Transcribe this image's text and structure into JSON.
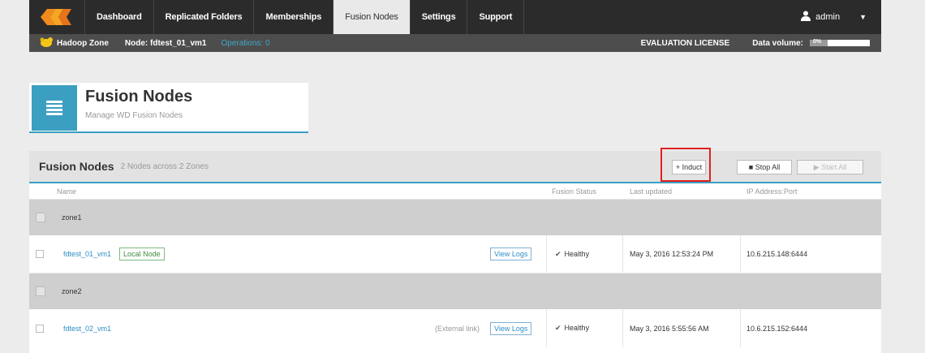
{
  "nav": {
    "tabs": [
      {
        "label": "Dashboard"
      },
      {
        "label": "Replicated Folders"
      },
      {
        "label": "Memberships"
      },
      {
        "label": "Fusion Nodes",
        "active": true
      },
      {
        "label": "Settings"
      },
      {
        "label": "Support"
      }
    ],
    "user": "admin",
    "logo_icon": "wandisco-logo-icon"
  },
  "subbar": {
    "zone": "Hadoop Zone",
    "node": "Node: fdtest_01_vm1",
    "operations": "Operations: 0",
    "license": "EVALUATION LICENSE",
    "data_volume_label": "Data volume:",
    "data_volume_text": "0%",
    "data_volume_fraction": 0.3
  },
  "title": {
    "heading": "Fusion Nodes",
    "subtitle": "Manage WD Fusion Nodes"
  },
  "panel": {
    "heading": "Fusion Nodes",
    "summary": "2 Nodes across 2 Zones",
    "buttons": {
      "induct": "+ Induct",
      "stop_all": "■ Stop All",
      "start_all": "▶ Start All"
    },
    "columns": {
      "name": "Name",
      "status": "Fusion Status",
      "updated": "Last updated",
      "ip": "IP Address:Port"
    },
    "zones": [
      {
        "name": "zone1",
        "node": {
          "name": "fdtest_01_vm1",
          "badge": "Local Node",
          "external": "",
          "view_logs": "View Logs",
          "status": "Healthy",
          "updated": "May 3, 2016 12:53:24 PM",
          "ip": "10.6.215.148:6444"
        }
      },
      {
        "name": "zone2",
        "node": {
          "name": "fdtest_02_vm1",
          "badge": "",
          "external": "(External link)",
          "view_logs": "View Logs",
          "status": "Healthy",
          "updated": "May 3, 2016 5:55:56 AM",
          "ip": "10.6.215.152:6444"
        }
      }
    ]
  },
  "colors": {
    "accent": "#3a9fc0",
    "nav_bg": "#2b2b2b",
    "highlight_box": "#e02020"
  }
}
